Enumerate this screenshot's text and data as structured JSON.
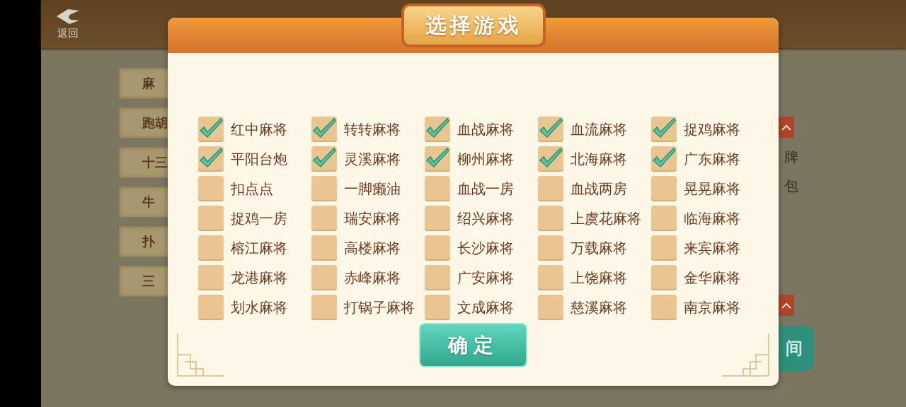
{
  "background": {
    "back_label": "返回",
    "side_tabs": [
      "麻",
      "跑胡",
      "十三",
      "牛",
      "扑",
      "三"
    ],
    "right_texts": [
      "牌",
      "包"
    ],
    "create_button": "间"
  },
  "dialog": {
    "title": "选择游戏",
    "games": [
      {
        "label": "红中麻将",
        "checked": true
      },
      {
        "label": "转转麻将",
        "checked": true
      },
      {
        "label": "血战麻将",
        "checked": true
      },
      {
        "label": "血流麻将",
        "checked": true
      },
      {
        "label": "捉鸡麻将",
        "checked": true
      },
      {
        "label": "平阳台炮",
        "checked": true
      },
      {
        "label": "灵溪麻将",
        "checked": true
      },
      {
        "label": "柳州麻将",
        "checked": true
      },
      {
        "label": "北海麻将",
        "checked": true
      },
      {
        "label": "广东麻将",
        "checked": true
      },
      {
        "label": "扣点点",
        "checked": false
      },
      {
        "label": "一脚癞油",
        "checked": false
      },
      {
        "label": "血战一房",
        "checked": false
      },
      {
        "label": "血战两房",
        "checked": false
      },
      {
        "label": "晃晃麻将",
        "checked": false
      },
      {
        "label": "捉鸡一房",
        "checked": false
      },
      {
        "label": "瑞安麻将",
        "checked": false
      },
      {
        "label": "绍兴麻将",
        "checked": false
      },
      {
        "label": "上虞花麻将",
        "checked": false
      },
      {
        "label": "临海麻将",
        "checked": false
      },
      {
        "label": "榕江麻将",
        "checked": false
      },
      {
        "label": "高楼麻将",
        "checked": false
      },
      {
        "label": "长沙麻将",
        "checked": false
      },
      {
        "label": "万载麻将",
        "checked": false
      },
      {
        "label": "来宾麻将",
        "checked": false
      },
      {
        "label": "龙港麻将",
        "checked": false
      },
      {
        "label": "赤峰麻将",
        "checked": false
      },
      {
        "label": "广安麻将",
        "checked": false
      },
      {
        "label": "上饶麻将",
        "checked": false
      },
      {
        "label": "金华麻将",
        "checked": false
      },
      {
        "label": "划水麻将",
        "checked": false
      },
      {
        "label": "打锅子麻将",
        "checked": false
      },
      {
        "label": "文成麻将",
        "checked": false
      },
      {
        "label": "慈溪麻将",
        "checked": false
      },
      {
        "label": "南京麻将",
        "checked": false
      }
    ],
    "confirm": "确定"
  }
}
